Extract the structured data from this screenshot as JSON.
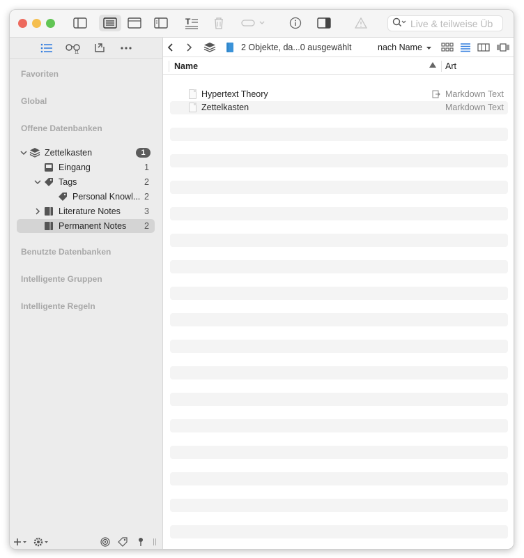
{
  "window": {
    "traffic_colors": [
      "#ed6a5e",
      "#f5bf4f",
      "#61c554"
    ]
  },
  "toolbar": {
    "search_placeholder": "Live & teilweise Üb",
    "icons": [
      "sidebar-icon",
      "list-view-icon",
      "preview-icon",
      "split-view-icon",
      "text-format-icon",
      "trash-icon",
      "flag-dropdown-icon",
      "info-icon",
      "inspector-icon",
      "warning-icon"
    ]
  },
  "sidebar": {
    "tabs": [
      "list-icon",
      "reading-glasses-icon",
      "import-icon",
      "more-icon"
    ],
    "sections": {
      "favorites": "Favoriten",
      "global": "Global",
      "open_databases": "Offene Datenbanken",
      "used_databases": "Benutzte Datenbanken",
      "smart_groups": "Intelligente Gruppen",
      "smart_rules": "Intelligente Regeln"
    },
    "tree": [
      {
        "label": "Zettelkasten",
        "badge": "1"
      },
      {
        "label": "Eingang",
        "count": "1"
      },
      {
        "label": "Tags",
        "count": "2"
      },
      {
        "label": "Personal Knowl...",
        "count": "2"
      },
      {
        "label": "Literature Notes",
        "count": "3"
      },
      {
        "label": "Permanent Notes",
        "count": "2"
      }
    ]
  },
  "navbar": {
    "status": "2 Objekte, da...0 ausgewählt",
    "sort": "nach Name"
  },
  "columns": {
    "name": "Name",
    "kind": "Art"
  },
  "files": [
    {
      "name": "Hypertext Theory",
      "kind": "Markdown Text"
    },
    {
      "name": "Zettelkasten",
      "kind": "Markdown Text"
    }
  ],
  "accent": "#4a90e2"
}
